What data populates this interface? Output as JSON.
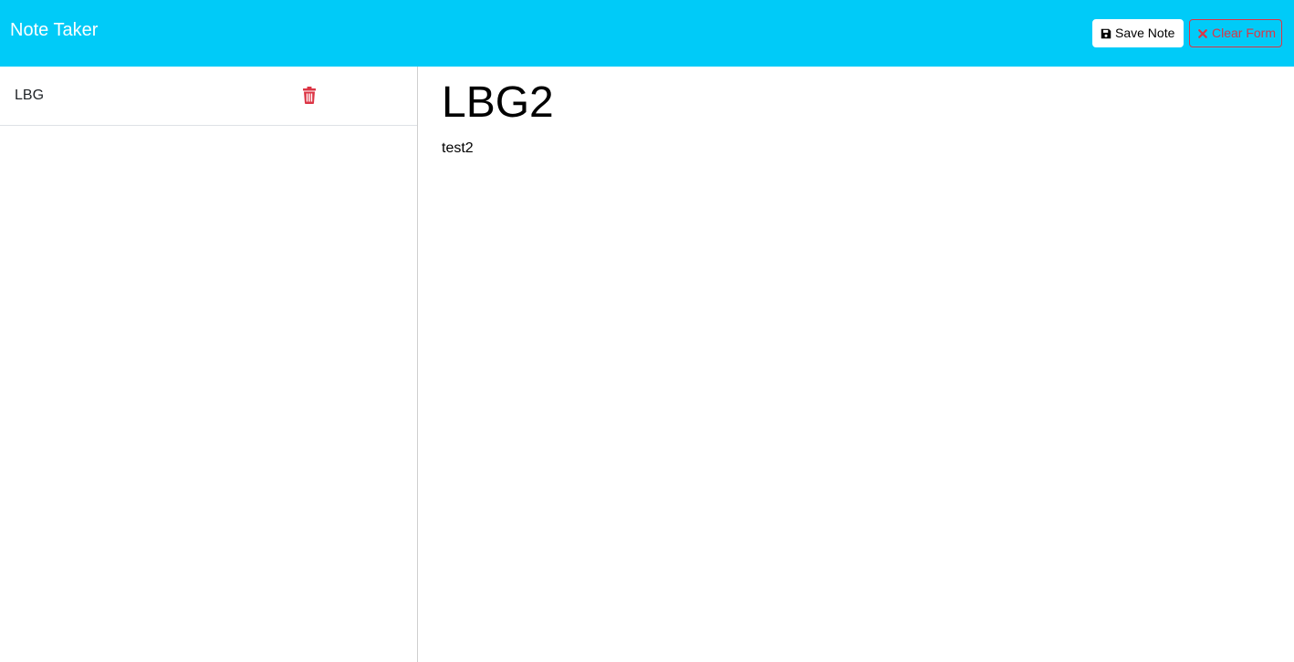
{
  "app": {
    "title": "Note Taker"
  },
  "toolbar": {
    "save_label": "Save Note",
    "clear_label": "Clear Form",
    "save_icon": "save-icon",
    "clear_icon": "x-icon"
  },
  "sidebar": {
    "notes": [
      {
        "title": "LBG",
        "delete_icon": "trash-icon"
      }
    ]
  },
  "editor": {
    "title": "LBG2",
    "text": "test2"
  },
  "colors": {
    "navbar": "#00cbf8",
    "danger": "#dc3545"
  }
}
